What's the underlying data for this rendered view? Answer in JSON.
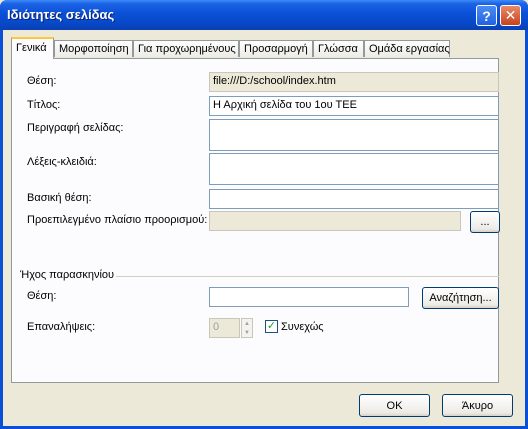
{
  "window": {
    "title": "Ιδιότητες σελίδας",
    "help_glyph": "?",
    "close_glyph": "✕"
  },
  "tabs": [
    {
      "label": "Γενικά",
      "active": true
    },
    {
      "label": "Μορφοποίηση",
      "active": false
    },
    {
      "label": "Για προχωρημένους",
      "active": false
    },
    {
      "label": "Προσαρμογή",
      "active": false
    },
    {
      "label": "Γλώσσα",
      "active": false
    },
    {
      "label": "Ομάδα εργασίας",
      "active": false
    }
  ],
  "general": {
    "location_label": "Θέση:",
    "location_value": "file:///D:/school/index.htm",
    "title_label": "Τίτλος:",
    "title_value": "Η Αρχική σελίδα του 1ου ΤΕΕ",
    "description_label": "Περιγραφή σελίδας:",
    "description_value": "",
    "keywords_label": "Λέξεις-κλειδιά:",
    "keywords_value": "",
    "base_location_label": "Βασική θέση:",
    "base_location_value": "",
    "default_target_label": "Προεπιλεγμένο πλαίσιο προορισμού:",
    "default_target_value": "",
    "target_button_glyph": "..."
  },
  "background_sound": {
    "group_label": "Ήχος παρασκηνίου",
    "location_label": "Θέση:",
    "location_value": "",
    "browse_label": "Αναζήτηση...",
    "loop_label": "Επαναλήψεις:",
    "loop_value": "0",
    "forever_label": "Συνεχώς",
    "forever_checked": true
  },
  "footer": {
    "ok_label": "OK",
    "cancel_label": "Άκυρο"
  }
}
